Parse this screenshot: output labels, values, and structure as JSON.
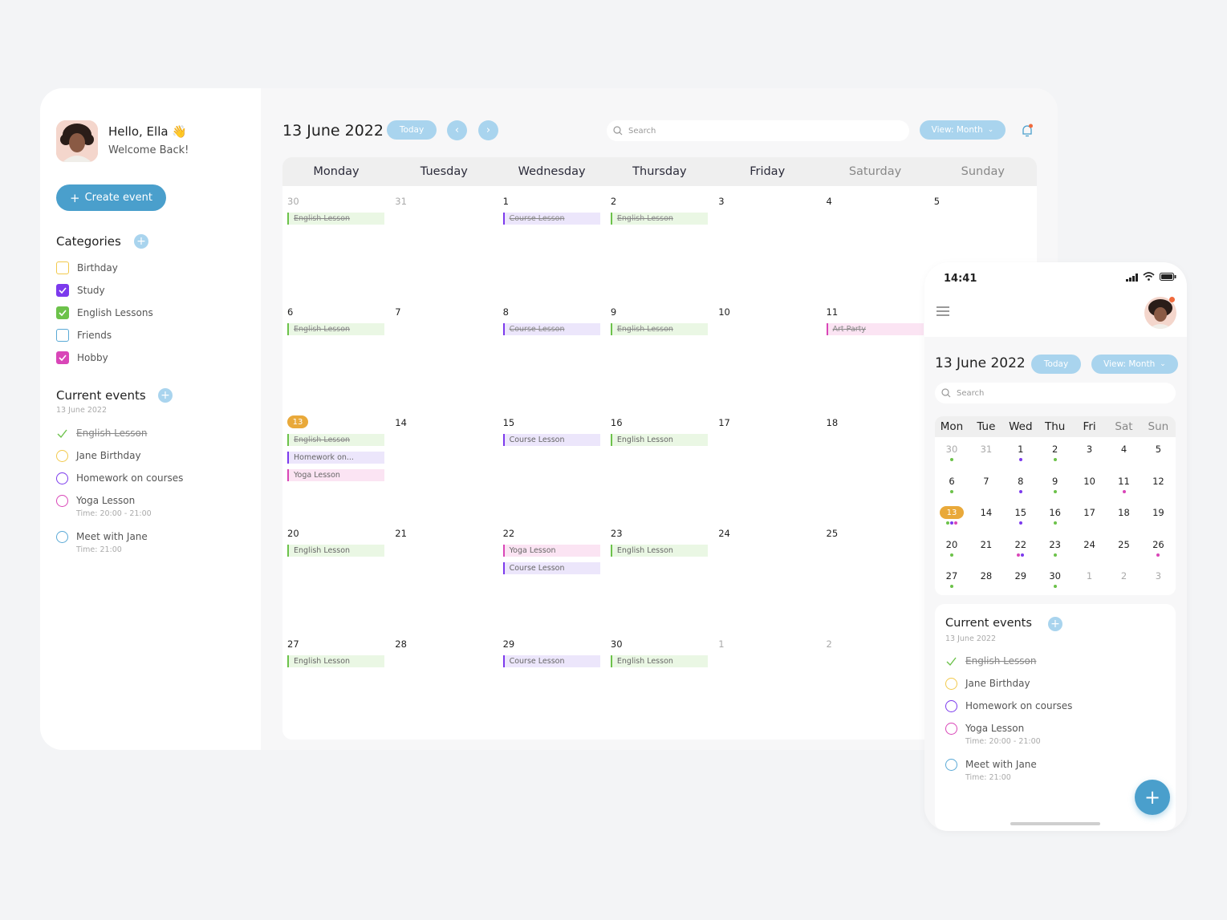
{
  "sidebar": {
    "greeting": "Hello, Ella 👋",
    "welcome": "Welcome Back!",
    "create_event": "Create event",
    "categories_title": "Categories",
    "categories": [
      {
        "label": "Birthday",
        "color": "#f2c94c",
        "checked": false
      },
      {
        "label": "Study",
        "color": "#7c3aed",
        "checked": true
      },
      {
        "label": "English Lessons",
        "color": "#6cc24a",
        "checked": true
      },
      {
        "label": "Friends",
        "color": "#5aa9d6",
        "checked": false
      },
      {
        "label": "Hobby",
        "color": "#d946b8",
        "checked": true
      }
    ],
    "current_events_title": "Current events",
    "current_events_date": "13 June 2022",
    "events": [
      {
        "label": "English Lesson",
        "color": "#6cc24a",
        "done": true,
        "sub": ""
      },
      {
        "label": "Jane Birthday",
        "color": "#f2c94c",
        "done": false,
        "sub": ""
      },
      {
        "label": "Homework on courses",
        "color": "#7c3aed",
        "done": false,
        "sub": ""
      },
      {
        "label": "Yoga Lesson",
        "color": "#d946b8",
        "done": false,
        "sub": "Time: 20:00 - 21:00"
      },
      {
        "label": "Meet with Jane",
        "color": "#5aa9d6",
        "done": false,
        "sub": "Time: 21:00"
      }
    ]
  },
  "header": {
    "title": "13 June 2022",
    "today": "Today",
    "search_placeholder": "Search",
    "view": "View: Month"
  },
  "calendar": {
    "days": [
      "Monday",
      "Tuesday",
      "Wednesday",
      "Thursday",
      "Friday",
      "Saturday",
      "Sunday"
    ],
    "weeks": [
      [
        {
          "n": "30",
          "muted": true,
          "events": [
            {
              "label": "English Lesson",
              "type": "green",
              "done": true
            }
          ]
        },
        {
          "n": "31",
          "muted": true,
          "events": []
        },
        {
          "n": "1",
          "muted": false,
          "events": [
            {
              "label": "Course Lesson",
              "type": "purple",
              "done": true
            }
          ]
        },
        {
          "n": "2",
          "muted": false,
          "events": [
            {
              "label": "English Lesson",
              "type": "green",
              "done": true
            }
          ]
        },
        {
          "n": "3",
          "muted": false,
          "events": []
        },
        {
          "n": "4",
          "muted": false,
          "events": []
        },
        {
          "n": "5",
          "muted": false,
          "events": []
        }
      ],
      [
        {
          "n": "6",
          "muted": false,
          "events": [
            {
              "label": "English Lesson",
              "type": "green",
              "done": true
            }
          ]
        },
        {
          "n": "7",
          "muted": false,
          "events": []
        },
        {
          "n": "8",
          "muted": false,
          "events": [
            {
              "label": "Course Lesson",
              "type": "purple",
              "done": true
            }
          ]
        },
        {
          "n": "9",
          "muted": false,
          "events": [
            {
              "label": "English Lesson",
              "type": "green",
              "done": true
            }
          ]
        },
        {
          "n": "10",
          "muted": false,
          "events": []
        },
        {
          "n": "11",
          "muted": false,
          "events": [
            {
              "label": "Art Party",
              "type": "pink",
              "done": true
            }
          ]
        },
        {
          "n": "",
          "muted": false,
          "events": []
        }
      ],
      [
        {
          "n": "13",
          "muted": false,
          "today": true,
          "events": [
            {
              "label": "English Lesson",
              "type": "green",
              "done": true
            },
            {
              "label": "Homework on...",
              "type": "purple",
              "done": false
            },
            {
              "label": "Yoga Lesson",
              "type": "pink",
              "done": false
            }
          ]
        },
        {
          "n": "14",
          "muted": false,
          "events": []
        },
        {
          "n": "15",
          "muted": false,
          "events": [
            {
              "label": "Course Lesson",
              "type": "purple",
              "done": false
            }
          ]
        },
        {
          "n": "16",
          "muted": false,
          "events": [
            {
              "label": "English Lesson",
              "type": "green",
              "done": false
            }
          ]
        },
        {
          "n": "17",
          "muted": false,
          "events": []
        },
        {
          "n": "18",
          "muted": false,
          "events": []
        },
        {
          "n": "",
          "muted": false,
          "events": []
        }
      ],
      [
        {
          "n": "20",
          "muted": false,
          "events": [
            {
              "label": "English Lesson",
              "type": "green",
              "done": false
            }
          ]
        },
        {
          "n": "21",
          "muted": false,
          "events": []
        },
        {
          "n": "22",
          "muted": false,
          "events": [
            {
              "label": "Yoga Lesson",
              "type": "pink",
              "done": false
            },
            {
              "label": "Course Lesson",
              "type": "purple",
              "done": false
            }
          ]
        },
        {
          "n": "23",
          "muted": false,
          "events": [
            {
              "label": "English Lesson",
              "type": "green",
              "done": false
            }
          ]
        },
        {
          "n": "24",
          "muted": false,
          "events": []
        },
        {
          "n": "25",
          "muted": false,
          "events": []
        },
        {
          "n": "",
          "muted": false,
          "events": []
        }
      ],
      [
        {
          "n": "27",
          "muted": false,
          "events": [
            {
              "label": "English Lesson",
              "type": "green",
              "done": false
            }
          ]
        },
        {
          "n": "28",
          "muted": false,
          "events": []
        },
        {
          "n": "29",
          "muted": false,
          "events": [
            {
              "label": "Course Lesson",
              "type": "purple",
              "done": false
            }
          ]
        },
        {
          "n": "30",
          "muted": false,
          "events": [
            {
              "label": "English Lesson",
              "type": "green",
              "done": false
            }
          ]
        },
        {
          "n": "1",
          "muted": true,
          "events": []
        },
        {
          "n": "2",
          "muted": true,
          "events": []
        },
        {
          "n": "",
          "muted": false,
          "events": []
        }
      ]
    ]
  },
  "phone": {
    "time": "14:41",
    "title": "13 June 2022",
    "today": "Today",
    "view": "View: Month",
    "search_placeholder": "Search",
    "days": [
      "Mon",
      "Tue",
      "Wed",
      "Thu",
      "Fri",
      "Sat",
      "Sun"
    ],
    "weeks": [
      [
        {
          "n": "30",
          "muted": true,
          "dots": [
            "#6cc24a"
          ]
        },
        {
          "n": "31",
          "muted": true,
          "dots": []
        },
        {
          "n": "1",
          "dots": [
            "#7c3aed"
          ]
        },
        {
          "n": "2",
          "dots": [
            "#6cc24a"
          ]
        },
        {
          "n": "3",
          "dots": []
        },
        {
          "n": "4",
          "dots": []
        },
        {
          "n": "5",
          "dots": []
        }
      ],
      [
        {
          "n": "6",
          "dots": [
            "#6cc24a"
          ]
        },
        {
          "n": "7",
          "dots": []
        },
        {
          "n": "8",
          "dots": [
            "#7c3aed"
          ]
        },
        {
          "n": "9",
          "dots": [
            "#6cc24a"
          ]
        },
        {
          "n": "10",
          "dots": []
        },
        {
          "n": "11",
          "dots": [
            "#d946b8"
          ]
        },
        {
          "n": "12",
          "dots": []
        }
      ],
      [
        {
          "n": "13",
          "today": true,
          "dots": [
            "#6cc24a",
            "#7c3aed",
            "#d946b8"
          ]
        },
        {
          "n": "14",
          "dots": []
        },
        {
          "n": "15",
          "dots": [
            "#7c3aed"
          ]
        },
        {
          "n": "16",
          "dots": [
            "#6cc24a"
          ]
        },
        {
          "n": "17",
          "dots": []
        },
        {
          "n": "18",
          "dots": []
        },
        {
          "n": "19",
          "dots": []
        }
      ],
      [
        {
          "n": "20",
          "dots": [
            "#6cc24a"
          ]
        },
        {
          "n": "21",
          "dots": []
        },
        {
          "n": "22",
          "dots": [
            "#d946b8",
            "#7c3aed"
          ]
        },
        {
          "n": "23",
          "dots": [
            "#6cc24a"
          ]
        },
        {
          "n": "24",
          "dots": []
        },
        {
          "n": "25",
          "dots": []
        },
        {
          "n": "26",
          "dots": [
            "#d946b8"
          ]
        }
      ],
      [
        {
          "n": "27",
          "dots": [
            "#6cc24a"
          ]
        },
        {
          "n": "28",
          "dots": []
        },
        {
          "n": "29",
          "dots": []
        },
        {
          "n": "30",
          "dots": [
            "#6cc24a"
          ]
        },
        {
          "n": "1",
          "muted": true,
          "dots": []
        },
        {
          "n": "2",
          "muted": true,
          "dots": []
        },
        {
          "n": "3",
          "muted": true,
          "dots": []
        }
      ]
    ],
    "current_events_title": "Current events",
    "current_events_date": "13 June 2022"
  },
  "colors": {
    "accent": "#4a9fcc",
    "accent_light": "#a9d4ee",
    "today": "#e9a93a"
  }
}
